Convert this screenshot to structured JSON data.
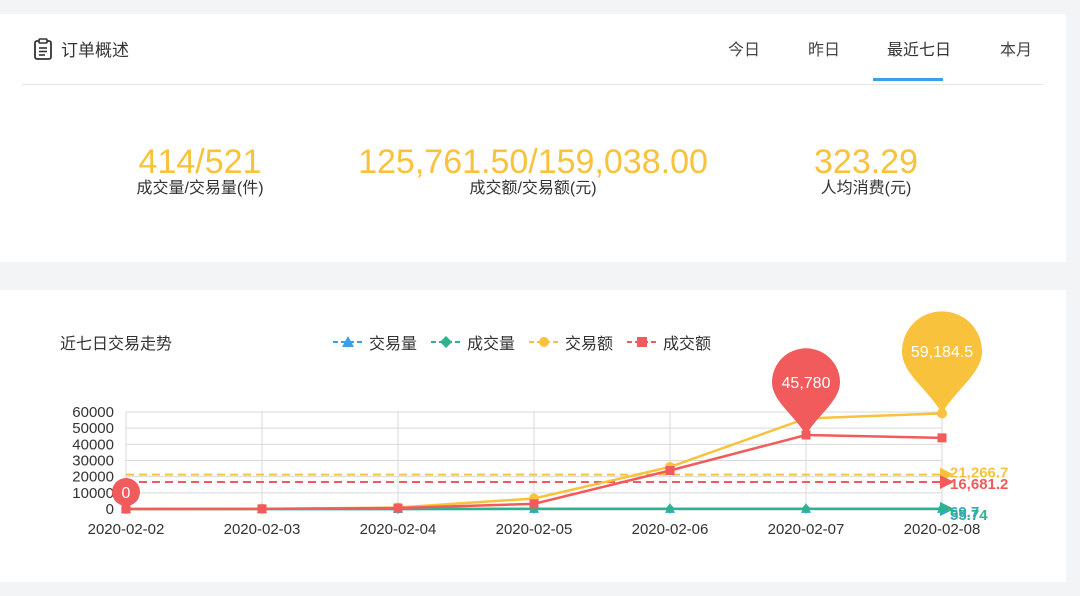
{
  "header": {
    "title": "订单概述",
    "tabs": [
      "今日",
      "昨日",
      "最近七日",
      "本月"
    ],
    "active_tab": 2
  },
  "stats": [
    {
      "value": "414/521",
      "label": "成交量/交易量(件)"
    },
    {
      "value": "125,761.50/159,038.00",
      "label": "成交额/交易额(元)"
    },
    {
      "value": "323.29",
      "label": "人均消费(元)"
    }
  ],
  "colors": {
    "accent": "#f9c23c",
    "tab_underline": "#3aa1e8",
    "series": [
      "#3aa1e8",
      "#2fb28e",
      "#f9c23c",
      "#f25b5b"
    ]
  },
  "chart_data": {
    "type": "line",
    "title": "近七日交易走势",
    "x": [
      "2020-02-02",
      "2020-02-03",
      "2020-02-04",
      "2020-02-05",
      "2020-02-06",
      "2020-02-07",
      "2020-02-08"
    ],
    "ylim": [
      0,
      60000
    ],
    "yticks": [
      0,
      10000,
      20000,
      30000,
      40000,
      50000,
      60000
    ],
    "grid": true,
    "legend_position": "top",
    "series": [
      {
        "name": "交易量",
        "marker": "triangle",
        "values": [
          10,
          10,
          20,
          60,
          70,
          80,
          70
        ],
        "average_label": "69.7"
      },
      {
        "name": "成交量",
        "marker": "diamond",
        "values": [
          10,
          10,
          15,
          50,
          60,
          70,
          60
        ],
        "average_label": "55.74"
      },
      {
        "name": "交易额",
        "marker": "circle",
        "values": [
          0,
          100,
          900,
          6500,
          26000,
          56000,
          59184.5
        ],
        "average_value": 21266.7,
        "average_label": "21,266.7",
        "max_pin": "59,184.5"
      },
      {
        "name": "成交额",
        "marker": "square",
        "values": [
          0,
          100,
          600,
          3200,
          23800,
          45780,
          44000
        ],
        "average_value": 16681.2,
        "average_label": "16,681.2",
        "max_pin": "45,780",
        "min_pin": "0"
      }
    ]
  }
}
